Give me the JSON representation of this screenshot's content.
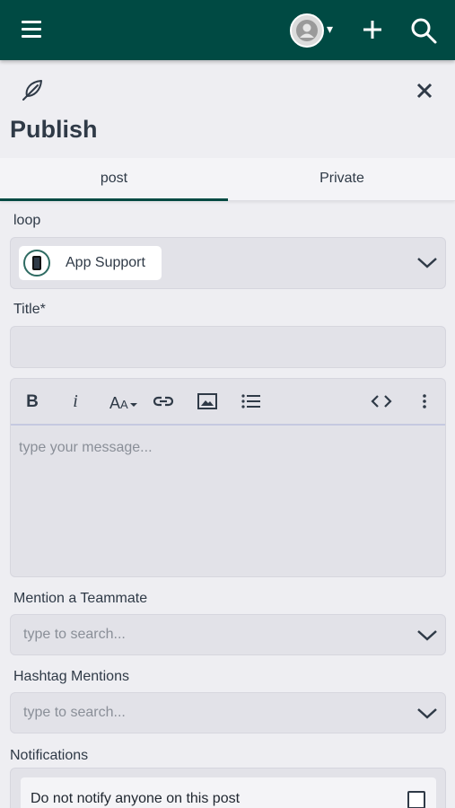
{
  "header": {
    "menu_icon": "hamburger-icon",
    "avatar_icon": "user-avatar-icon",
    "caret": "▾",
    "add_icon": "plus-icon",
    "search_icon": "search-icon",
    "background_color": "#004a43"
  },
  "panel": {
    "icon": "feather-icon",
    "close_icon": "close-icon",
    "title": "Publish"
  },
  "tabs": [
    {
      "label": "post",
      "active": true
    },
    {
      "label": "Private",
      "active": false
    }
  ],
  "form": {
    "loop": {
      "label": "loop",
      "selected_label": "App Support",
      "selected_icon": "mobile-phone-icon"
    },
    "title": {
      "label": "Title*",
      "value": ""
    },
    "editor": {
      "placeholder": "type your message...",
      "toolbar": [
        "bold-icon",
        "italic-icon",
        "font-size-icon",
        "link-icon",
        "image-icon",
        "bulleted-list-icon",
        "code-icon",
        "more-icon"
      ]
    },
    "mention": {
      "label": "Mention a Teammate",
      "placeholder": "type to search..."
    },
    "hashtags": {
      "label": "Hashtag Mentions",
      "placeholder": "type to search..."
    },
    "notifications": {
      "label": "Notifications",
      "option_label": "Do not notify anyone on this post",
      "checked": false
    }
  }
}
